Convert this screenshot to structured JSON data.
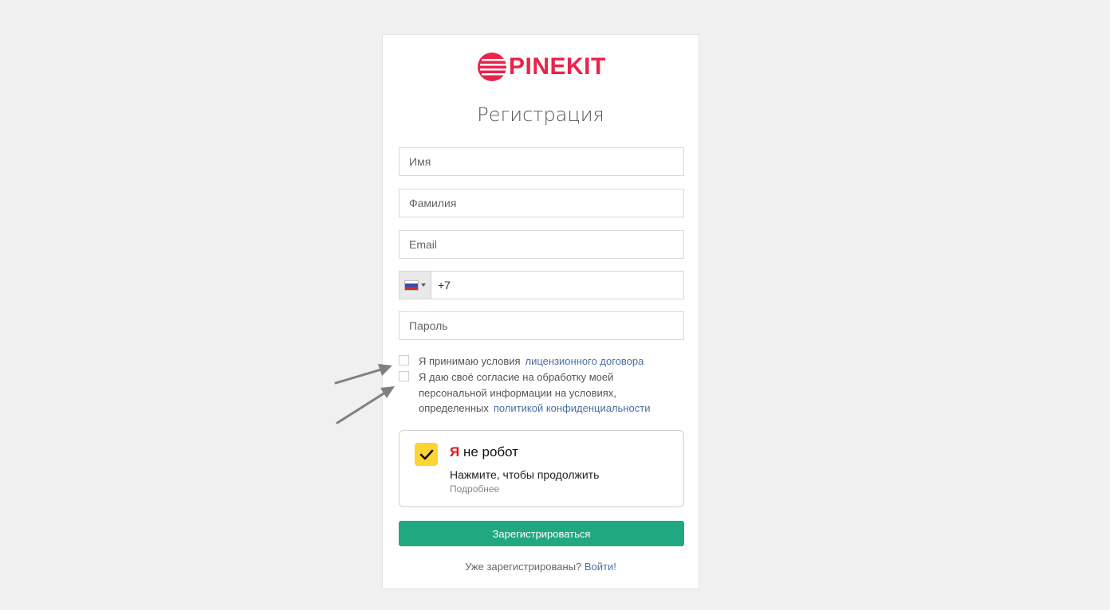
{
  "brand": {
    "name": "PINEKIT",
    "color": "#e8244b"
  },
  "form": {
    "title": "Регистрация",
    "first_name_placeholder": "Имя",
    "last_name_placeholder": "Фамилия",
    "email_placeholder": "Email",
    "phone_value": "+7",
    "password_placeholder": "Пароль"
  },
  "agreements": {
    "license_text": "Я принимаю условия",
    "license_link": "лицензионного договора",
    "privacy_text": "Я даю своё согласие на обработку моей персональной информации на условиях, определенных",
    "privacy_link": "политикой конфиденциальности"
  },
  "captcha": {
    "ya": "Я",
    "title_rest": " не робот",
    "subtitle": "Нажмите, чтобы продолжить",
    "more": "Подробнее"
  },
  "submit_label": "Зарегистрироваться",
  "footer": {
    "question": "Уже зарегистрированы?",
    "login_link": "Войти!"
  },
  "colors": {
    "accent": "#1fa882",
    "link": "#4a6fa5",
    "captcha_yellow": "#fdd431"
  },
  "icons": [
    "pinekit-logo-icon",
    "russia-flag-icon",
    "chevron-down-icon",
    "checkmark-icon",
    "arrow-icon"
  ]
}
